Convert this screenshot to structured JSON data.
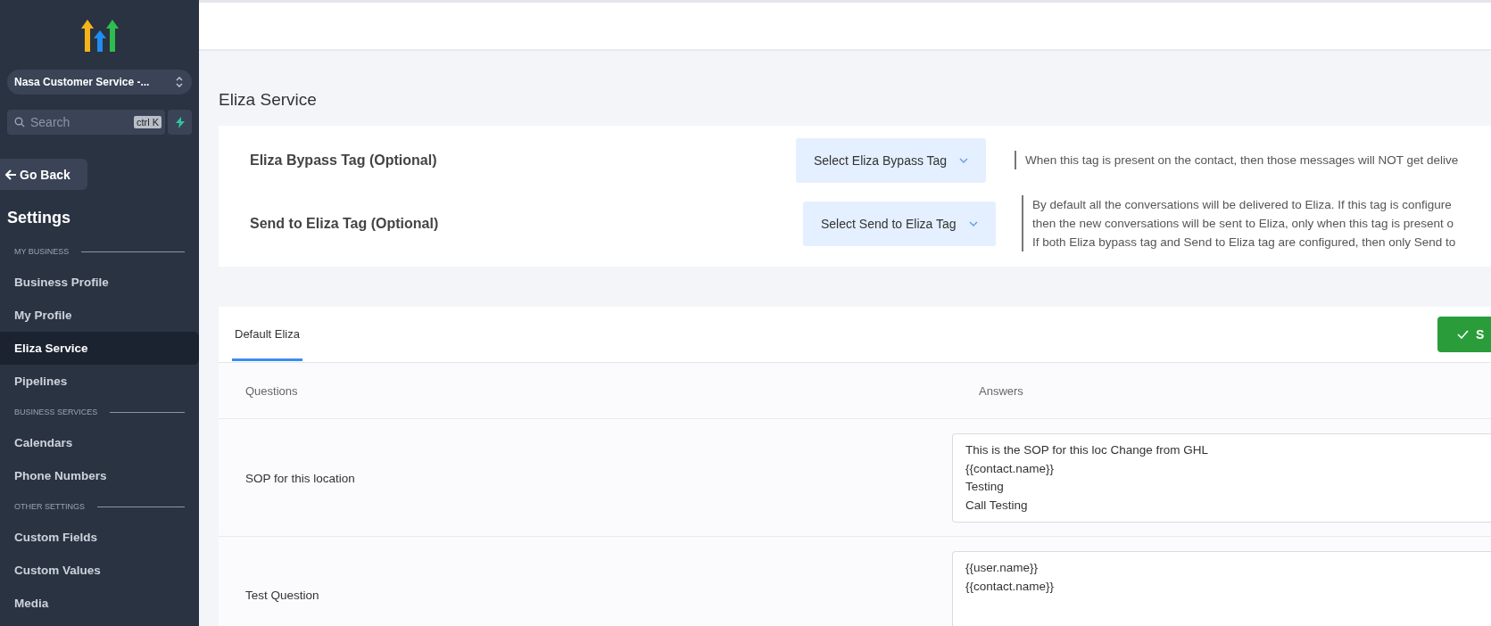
{
  "sidebar": {
    "location": "Nasa Customer Service -...",
    "search": {
      "placeholder": "Search",
      "shortcut": "ctrl K"
    },
    "back_button": "Go Back",
    "title": "Settings",
    "sections": [
      {
        "heading": "MY BUSINESS",
        "items": [
          {
            "label": "Business Profile",
            "selected": false
          },
          {
            "label": "My Profile",
            "selected": false
          },
          {
            "label": "Eliza Service",
            "selected": true
          },
          {
            "label": "Pipelines",
            "selected": false
          }
        ]
      },
      {
        "heading": "BUSINESS SERVICES",
        "items": [
          {
            "label": "Calendars",
            "selected": false
          },
          {
            "label": "Phone Numbers",
            "selected": false
          }
        ]
      },
      {
        "heading": "OTHER SETTINGS",
        "items": [
          {
            "label": "Custom Fields",
            "selected": false
          },
          {
            "label": "Custom Values",
            "selected": false
          },
          {
            "label": "Media",
            "selected": false
          }
        ]
      }
    ]
  },
  "page_title": "Eliza Service",
  "tag_settings": [
    {
      "label": "Eliza Bypass Tag (Optional)",
      "dropdown": "Select Eliza Bypass Tag",
      "description": [
        "When this tag is present on the contact, then those messages will NOT get delive"
      ]
    },
    {
      "label": "Send to Eliza Tag (Optional)",
      "dropdown": "Select Send to Eliza Tag",
      "description": [
        "By default all the conversations will be delivered to Eliza. If this tag is configure",
        "then the new conversations will be sent to Eliza, only when this tag is present o",
        "If both Eliza bypass tag and Send to Eliza tag are configured, then only Send to"
      ]
    }
  ],
  "tabs": [
    {
      "label": "Default Eliza",
      "selected": true
    }
  ],
  "save_button": "S",
  "table": {
    "columns": [
      "Questions",
      "Answers"
    ],
    "rows": [
      {
        "question": "SOP for this location",
        "answer": [
          "This is the SOP for this loc Change from GHL",
          "{{contact.name}}",
          "Testing",
          "Call Testing"
        ]
      },
      {
        "question": "Test Question",
        "answer": [
          "{{user.name}}",
          "{{contact.name}}"
        ]
      }
    ]
  }
}
